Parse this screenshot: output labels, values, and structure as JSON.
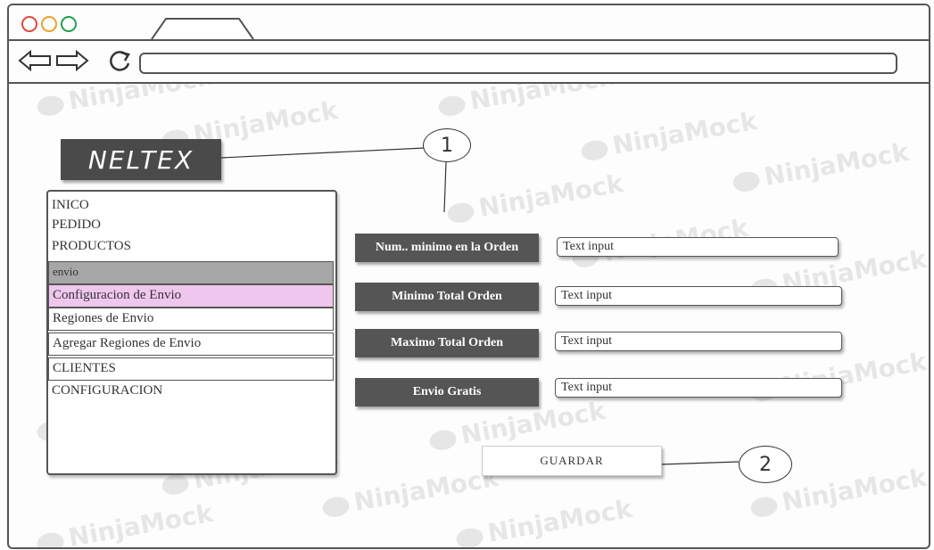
{
  "browser": {
    "tab_label": "",
    "url": ""
  },
  "watermark": "NinjaMock",
  "app": {
    "logo": "NELTEX"
  },
  "menu": {
    "items": [
      {
        "label": "INICO"
      },
      {
        "label": "PEDIDO"
      },
      {
        "label": "PRODUCTOS"
      },
      {
        "label": "envio",
        "state": "highlighted-gray"
      },
      {
        "label": "Configuracion de Envio",
        "state": "selected-pink"
      },
      {
        "label": "Regiones de Envio"
      },
      {
        "label": "Agregar Regiones de Envio"
      },
      {
        "label": "CLIENTES"
      },
      {
        "label": "CONFIGURACION"
      }
    ]
  },
  "form": {
    "fields": [
      {
        "label": "Num.. minimo en la Orden",
        "value": "Text input"
      },
      {
        "label": "Minimo Total Orden",
        "value": "Text input"
      },
      {
        "label": "Maximo Total Orden",
        "value": "Text input"
      },
      {
        "label": "Envio Gratis",
        "value": "Text input"
      }
    ],
    "save_label": "GUARDAR"
  },
  "callouts": {
    "first": "1",
    "second": "2"
  },
  "colors": {
    "label_bg": "#555555",
    "menu_gray": "#a6a6a6",
    "menu_pink": "#efc6ee",
    "dot_red": "#e2453b",
    "dot_yellow": "#eda12a",
    "dot_green": "#1fa34a"
  }
}
